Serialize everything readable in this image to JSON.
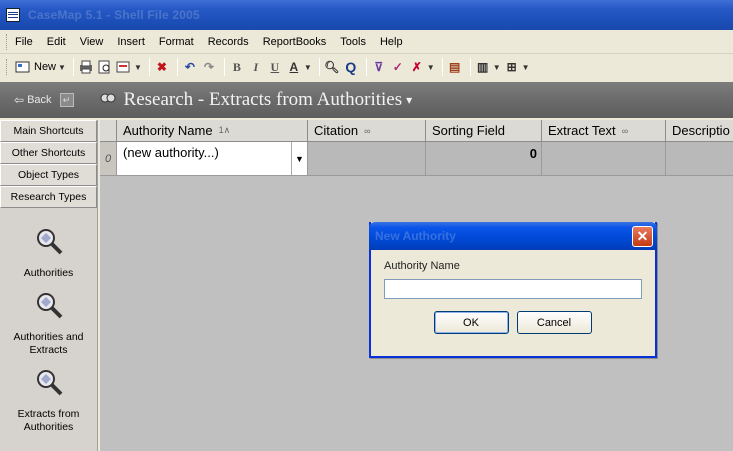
{
  "window": {
    "title": "CaseMap 5.1 - Shell File 2005"
  },
  "menu": [
    "File",
    "Edit",
    "View",
    "Insert",
    "Format",
    "Records",
    "ReportBooks",
    "Tools",
    "Help"
  ],
  "toolbar": {
    "new_label": "New",
    "bold": "B",
    "italic": "I",
    "underline": "U",
    "font_color": "A"
  },
  "nav": {
    "back_label": "Back",
    "title": "Research - Extracts from Authorities"
  },
  "shortcuts": [
    "Main Shortcuts",
    "Other Shortcuts",
    "Object Types",
    "Research Types"
  ],
  "research_types": [
    {
      "label": "Authorities",
      "icon": "magnifier-icon"
    },
    {
      "label": "Authorities and Extracts",
      "icon": "magnifier-icon"
    },
    {
      "label": "Extracts from Authorities",
      "icon": "magnifier-icon"
    }
  ],
  "grid": {
    "columns": [
      {
        "label": "Authority Name",
        "marker": "1∧"
      },
      {
        "label": "Citation",
        "marker": "∞"
      },
      {
        "label": "Sorting Field",
        "marker": ""
      },
      {
        "label": "Extract Text",
        "marker": "∞"
      },
      {
        "label": "Descriptio",
        "marker": ""
      }
    ],
    "row": {
      "selector": "0",
      "authority_name": "(new authority...)",
      "sorting_field": "0"
    }
  },
  "dialog": {
    "title": "New Authority",
    "field_label": "Authority Name",
    "field_value": "",
    "ok_label": "OK",
    "cancel_label": "Cancel"
  }
}
